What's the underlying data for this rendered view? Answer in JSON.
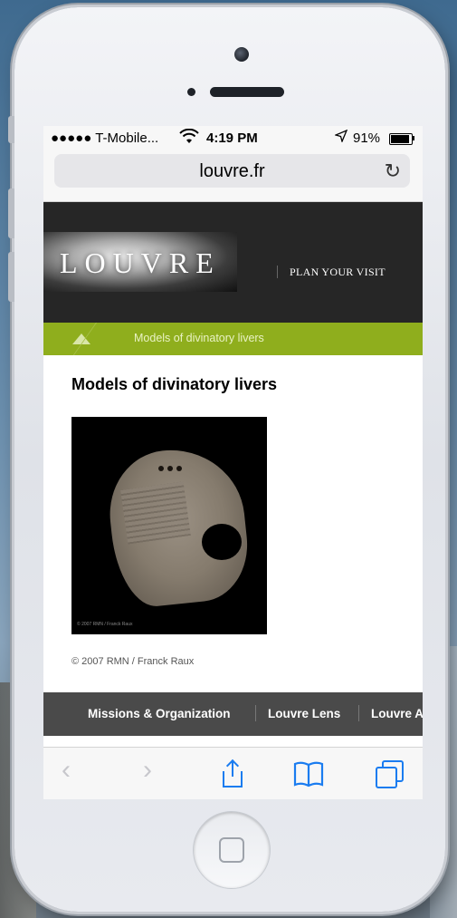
{
  "status_bar": {
    "carrier": "●●●●● T-Mobile...",
    "wifi_icon": "wifi-icon",
    "time": "4:19 PM",
    "location_icon": "location-arrow-icon",
    "battery_percent": "91%",
    "battery_level": 0.91
  },
  "browser": {
    "url": "louvre.fr",
    "reload_glyph": "↻"
  },
  "site": {
    "logo_text": "LOUVRE",
    "plan_visit": "PLAN YOUR VISIT",
    "breadcrumb": "Models of divinatory livers",
    "title": "Models of divinatory livers",
    "artwork_credit": "© 2007 RMN / Franck Raux",
    "copyright": "© 2007 RMN / Franck Raux",
    "footer_nav": [
      "Missions & Organization",
      "Louvre Lens",
      "Louvre A"
    ]
  },
  "toolbar": {
    "back_glyph": "‹",
    "forward_glyph": "›"
  },
  "colors": {
    "breadcrumb_green": "#8fae1d",
    "header_dark": "#262626",
    "ios_blue": "#1a7cf0"
  }
}
